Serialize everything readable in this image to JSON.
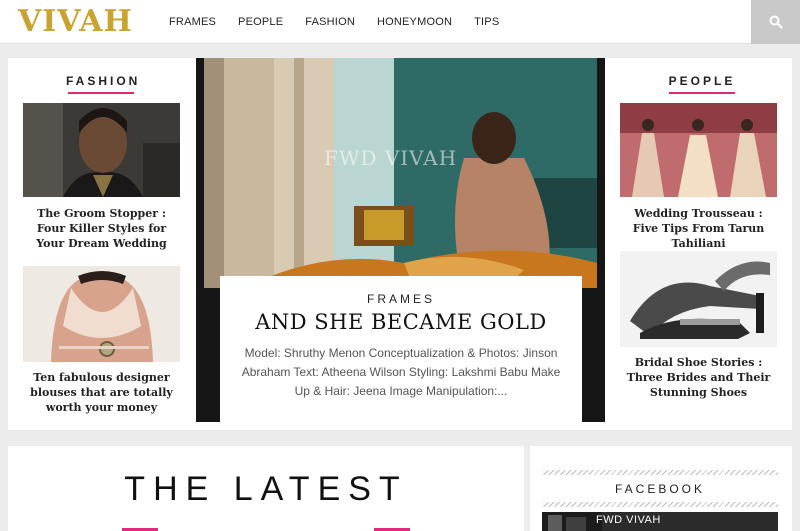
{
  "header": {
    "logo": "VIVAH",
    "nav": [
      "FRAMES",
      "PEOPLE",
      "FASHION",
      "HONEYMOON",
      "TIPS"
    ],
    "search_icon": "search-icon"
  },
  "left": {
    "heading": "FASHION",
    "cards": [
      {
        "title": "The Groom Stopper : Four Killer Styles for Your Dream Wedding"
      },
      {
        "title": "Ten fabulous designer blouses that are totally worth your money"
      }
    ]
  },
  "feature": {
    "watermark": "FWD VIVAH",
    "category": "FRAMES",
    "title": "AND SHE BECAME GOLD",
    "excerpt": "Model: Shruthy Menon Conceptualization & Photos: Jinson Abraham Text: Atheena Wilson Styling: Lakshmi Babu Make Up & Hair: Jeena Image Manipulation:..."
  },
  "right": {
    "heading": "PEOPLE",
    "cards": [
      {
        "title": "Wedding Trousseau : Five Tips From Tarun Tahiliani"
      },
      {
        "title": "Bridal Shoe Stories : Three Brides and Their Stunning Shoes"
      }
    ]
  },
  "latest": {
    "heading": "THE LATEST"
  },
  "facebook": {
    "heading": "FACEBOOK",
    "page_name": "FWD VIVAH"
  },
  "colors": {
    "accent": "#e0287c",
    "logo": "#c9a32e"
  }
}
